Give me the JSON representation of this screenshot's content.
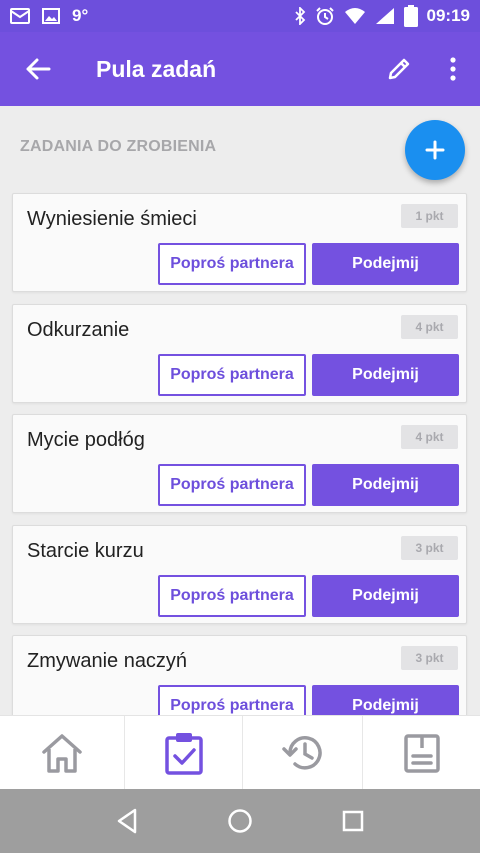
{
  "status_bar": {
    "temperature": "9°",
    "time": "09:19",
    "battery_level": "93",
    "icons": [
      "mail-icon",
      "image-icon",
      "bluetooth-icon",
      "alarm-icon",
      "wifi-icon",
      "signal-icon",
      "battery-icon"
    ]
  },
  "app_bar": {
    "title": "Pula zadań",
    "icons": [
      "back-arrow-icon",
      "edit-pencil-icon",
      "more-vert-icon"
    ]
  },
  "section": {
    "title": "ZADANIA DO ZROBIENIA",
    "fab_icon": "plus-icon"
  },
  "tasks": [
    {
      "name": "Wyniesienie śmieci",
      "points": "1 pkt",
      "ask_label": "Poproś partnera",
      "take_label": "Podejmij"
    },
    {
      "name": "Odkurzanie",
      "points": "4 pkt",
      "ask_label": "Poproś partnera",
      "take_label": "Podejmij"
    },
    {
      "name": "Mycie podłóg",
      "points": "4 pkt",
      "ask_label": "Poproś partnera",
      "take_label": "Podejmij"
    },
    {
      "name": "Starcie kurzu",
      "points": "3 pkt",
      "ask_label": "Poproś partnera",
      "take_label": "Podejmij"
    },
    {
      "name": "Zmywanie naczyń",
      "points": "3 pkt",
      "ask_label": "Poproś partnera",
      "take_label": "Podejmij"
    }
  ],
  "bottom_nav": {
    "items": [
      "home-icon",
      "task-clipboard-icon",
      "history-icon",
      "list-clipboard-icon"
    ],
    "active_index": 1
  },
  "system_nav": [
    "back-triangle-icon",
    "home-circle-icon",
    "recents-square-icon"
  ],
  "colors": {
    "primary": "#7451e0",
    "fab": "#1a8ff0",
    "inactive_icon": "#9a9aa0"
  }
}
